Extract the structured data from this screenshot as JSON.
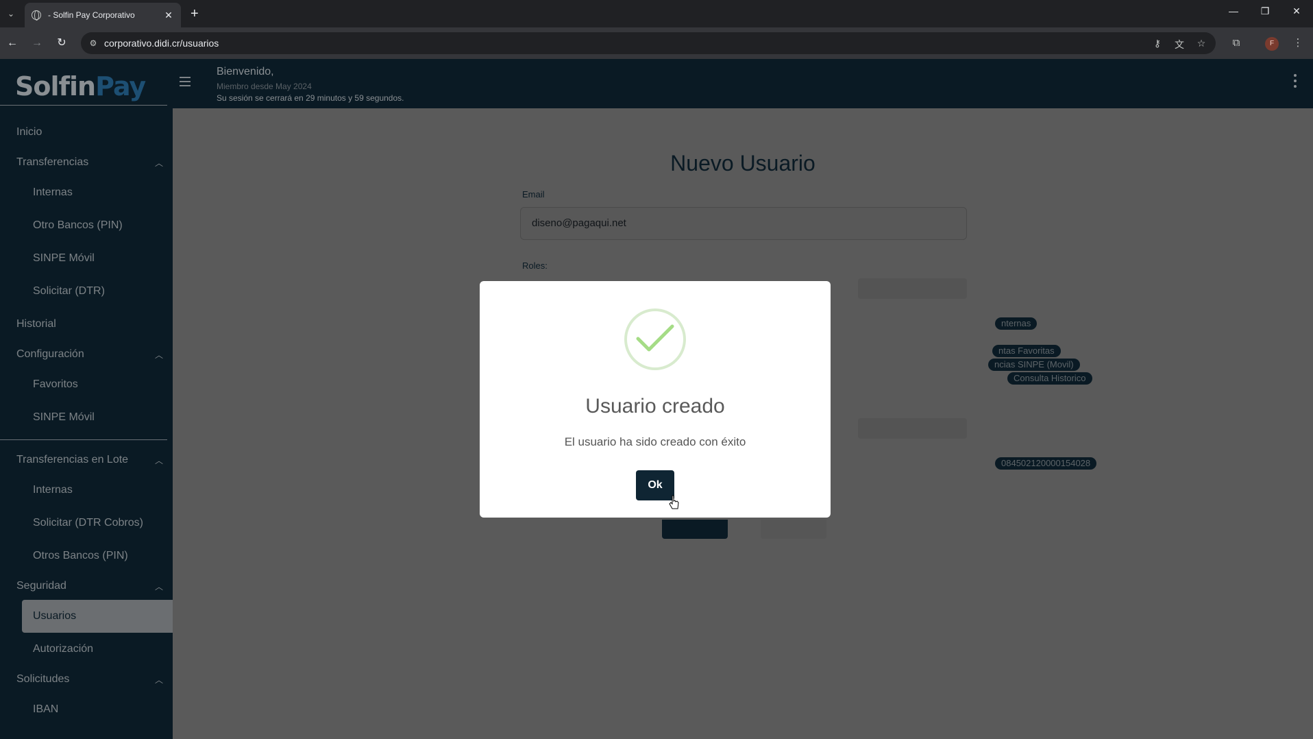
{
  "browser": {
    "tab_title": "- Solfin Pay Corporativo",
    "url": "corporativo.didi.cr/usuarios",
    "profile_initial": "F"
  },
  "brand": {
    "part1": "Solfin",
    "part2": "Pay"
  },
  "header": {
    "welcome": "Bienvenido,",
    "member_since": "Miembro desde May 2024",
    "session_notice": "Su sesión se cerrará en 29 minutos y 59 segundos."
  },
  "sidebar": {
    "inicio": "Inicio",
    "transferencias": "Transferencias",
    "internas": "Internas",
    "otro_bancos_pin": "Otro Bancos (PIN)",
    "sinpe_movil": "SINPE Móvil",
    "solicitar_dtr": "Solicitar (DTR)",
    "historial": "Historial",
    "configuracion": "Configuración",
    "favoritos": "Favoritos",
    "config_sinpe_movil": "SINPE Móvil",
    "transferencias_lote": "Transferencias en Lote",
    "lote_internas": "Internas",
    "solicitar_dtr_cobros": "Solicitar (DTR Cobros)",
    "otros_bancos_pin": "Otros Bancos (PIN)",
    "seguridad": "Seguridad",
    "usuarios": "Usuarios",
    "autorizacion": "Autorización",
    "solicitudes": "Solicitudes",
    "iban": "IBAN"
  },
  "form": {
    "title": "Nuevo Usuario",
    "email_label": "Email",
    "email_value": "diseno@pagaqui.net",
    "roles_label": "Roles:",
    "chips": {
      "internas": "nternas",
      "favoritas": "ntas Favoritas",
      "sinpe": "ncias SINPE (Movil)",
      "historico": "Consulta Historico",
      "account": "084502120000154028"
    }
  },
  "modal": {
    "title": "Usuario creado",
    "message": "El usuario ha sido creado con éxito",
    "ok_label": "Ok"
  }
}
